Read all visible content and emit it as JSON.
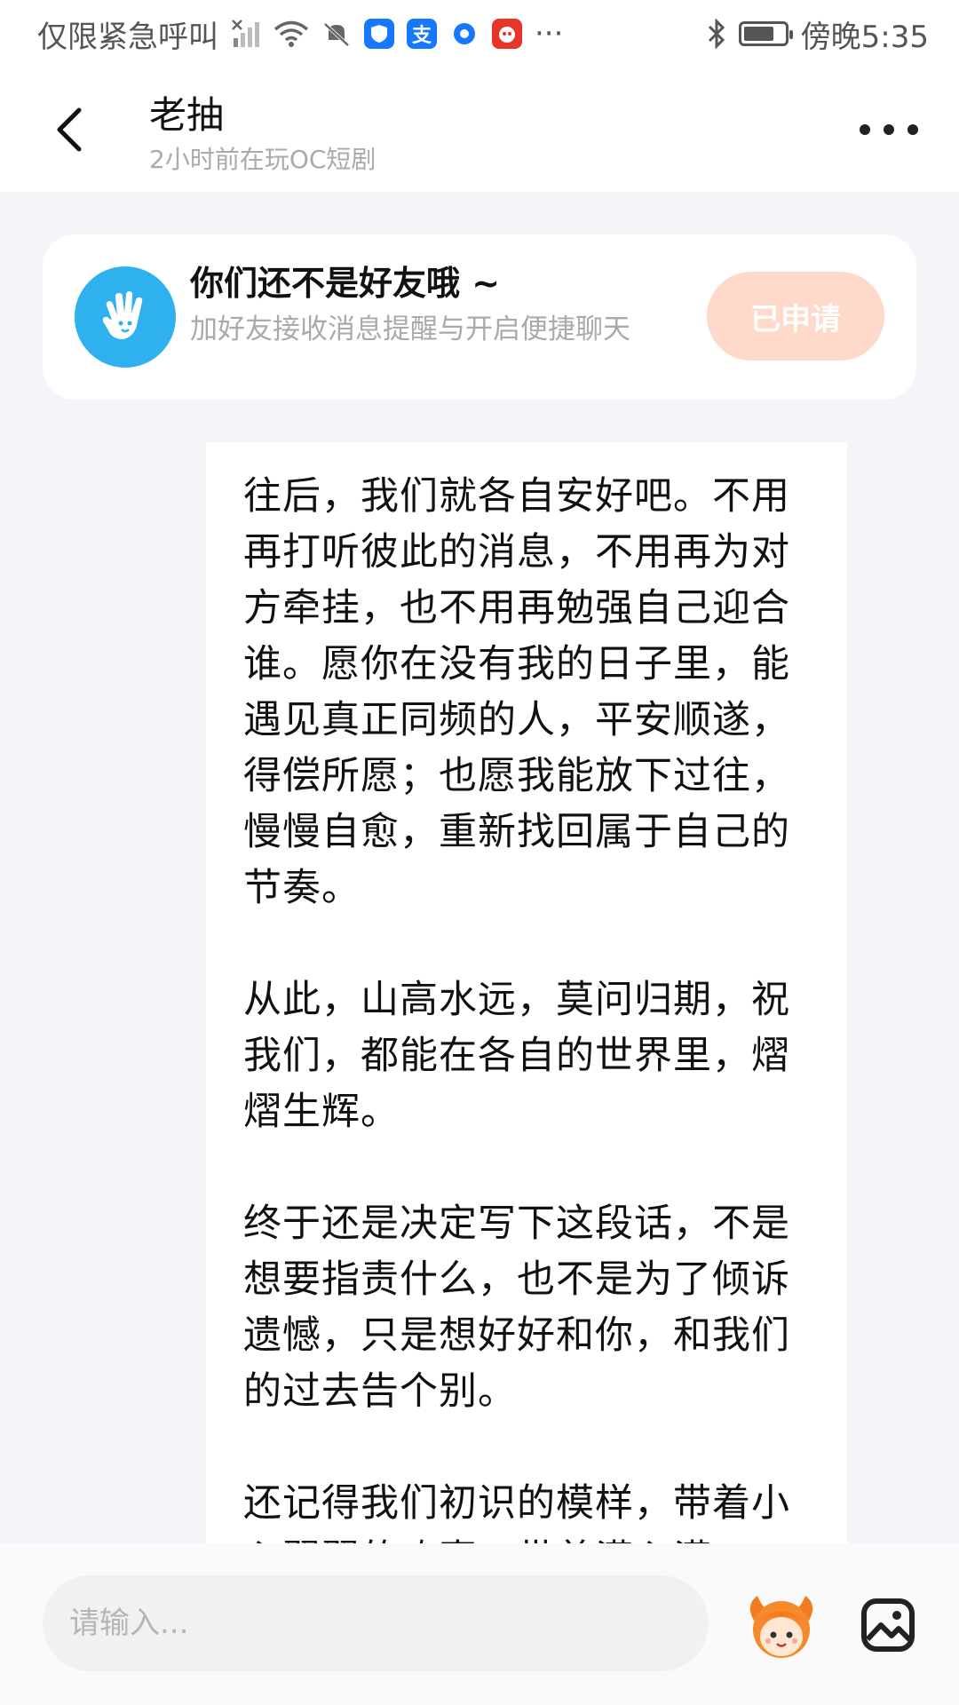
{
  "status_bar": {
    "carrier": "仅限紧急呼叫",
    "time": "傍晚5:35",
    "more": "···",
    "pay_badge": "支",
    "battery_level_percent": 75,
    "badge_colors": {
      "shield": "#1677ff",
      "pay": "#1677ff",
      "circle": "#1677ff",
      "red": "#e8352a"
    }
  },
  "header": {
    "name": "老抽",
    "status": "2小时前在玩OC短剧"
  },
  "friend_card": {
    "title": "你们还不是好友哦 ~",
    "description": "加好友接收消息提醒与开启便捷聊天",
    "button": "已申请",
    "avatar_icon": "waving-hand-icon",
    "accent": "#2fb0ef",
    "button_color": "#ffd9c9"
  },
  "message": {
    "paragraphs": [
      "往后，我们就各自安好吧。不用再打听彼此的消息，不用再为对方牵挂，也不用再勉强自己迎合谁。愿你在没有我的日子里，能遇见真正同频的人，平安顺遂，得偿所愿；也愿我能放下过往，慢慢自愈，重新找回属于自己的节奏。",
      "从此，山高水远，莫问归期，祝我们，都能在各自的世界里，熠熠生辉。",
      "终于还是决定写下这段话，不是想要指责什么，也不是为了倾诉遗憾，只是想好好和你，和我们的过去告个别。",
      "还记得我们初识的模样，带着小心翼翼的欢喜，带着满心满"
    ]
  },
  "input_bar": {
    "placeholder": "请输入...",
    "emoji_icon": "mascot-emoji-icon",
    "image_icon": "image-icon"
  }
}
